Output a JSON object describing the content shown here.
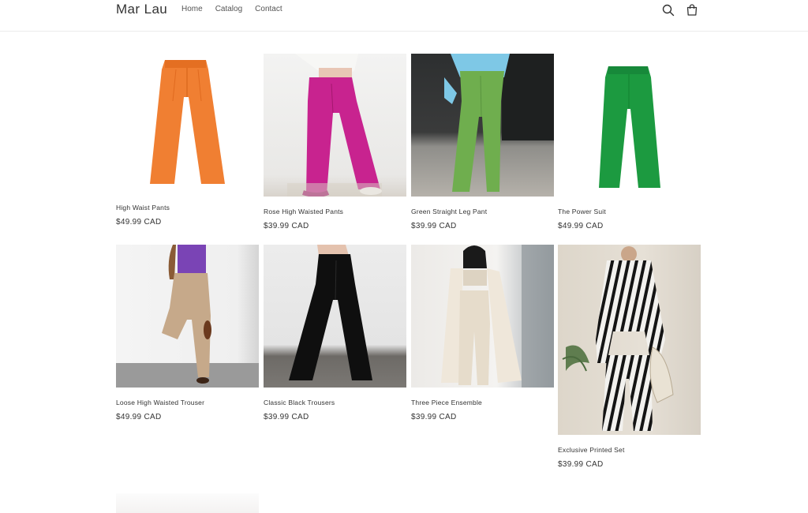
{
  "header": {
    "brand": "Mar Lau",
    "nav": [
      "Home",
      "Catalog",
      "Contact"
    ],
    "search_icon": "search-icon",
    "cart_icon": "cart-icon"
  },
  "products": [
    {
      "title": "High Waist Pants",
      "price": "$49.99 CAD",
      "image": "orange-pants-on-white"
    },
    {
      "title": "Rose High Waisted Pants",
      "price": "$39.99 CAD",
      "image": "pink-pants-model"
    },
    {
      "title": "Green Straight Leg Pant",
      "price": "$39.99 CAD",
      "image": "green-pants-model"
    },
    {
      "title": "The Power Suit",
      "price": "$49.99 CAD",
      "image": "green-pants-on-white"
    },
    {
      "title": "Loose High Waisted Trouser",
      "price": "$49.99 CAD",
      "image": "beige-trouser-model"
    },
    {
      "title": "Classic Black Trousers",
      "price": "$39.99 CAD",
      "image": "black-trouser-model"
    },
    {
      "title": "Three Piece Ensemble",
      "price": "$39.99 CAD",
      "image": "cream-ensemble-model"
    },
    {
      "title": "Exclusive Printed Set",
      "price": "$39.99 CAD",
      "image": "striped-printed-set-model"
    }
  ],
  "colors": {
    "text": "#333333",
    "border": "#ececec",
    "orange": "#f07f32",
    "pink": "#c8238f",
    "green_light": "#6fae4e",
    "green_dark": "#1c9a40"
  }
}
